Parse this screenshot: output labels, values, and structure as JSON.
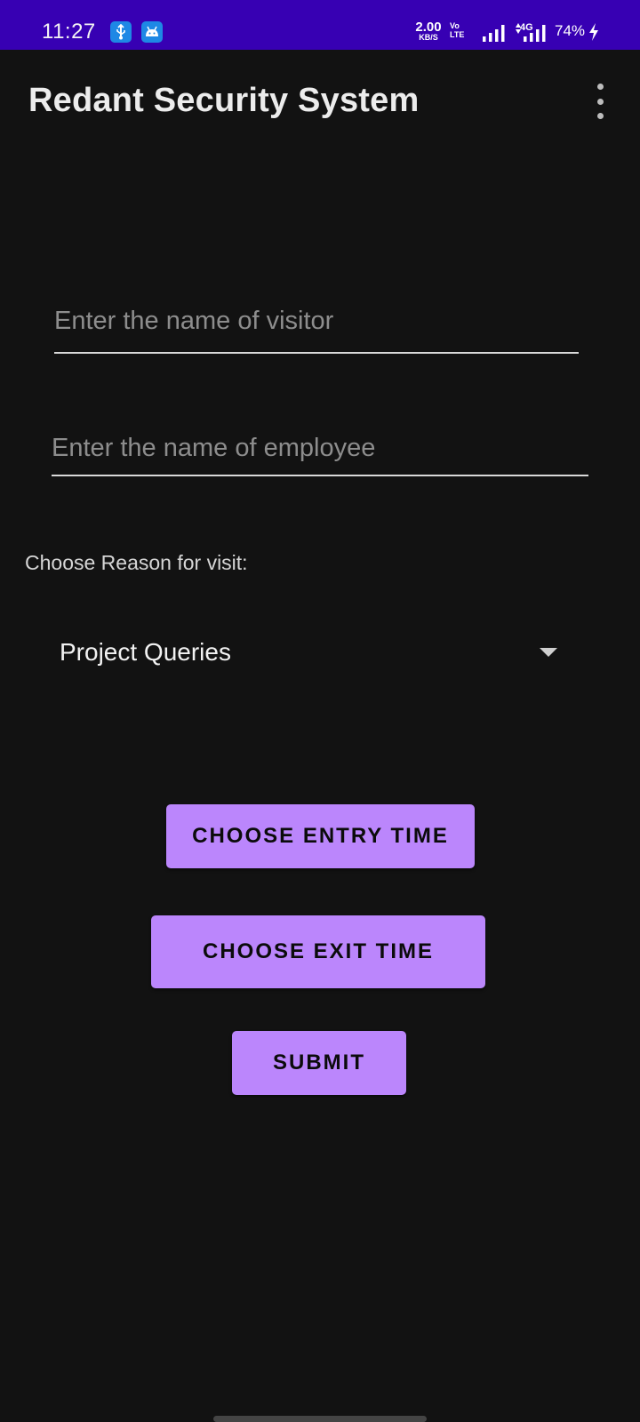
{
  "status_bar": {
    "time": "11:27",
    "notif_icons": [
      "usb-icon",
      "android-icon"
    ],
    "net_speed_value": "2.00",
    "net_speed_unit": "KB/S",
    "volte_top": "Vo",
    "volte_bottom": "LTE",
    "net_label": "4G",
    "battery": "74%",
    "background": "#3700b3"
  },
  "app_bar": {
    "title": "Redant Security System",
    "overflow_icon": "more-vert-icon"
  },
  "form": {
    "visitor_placeholder": "Enter the name of visitor",
    "employee_placeholder": "Enter the name of employee",
    "reason_label": "Choose Reason for visit:",
    "reason_selected": "Project Queries"
  },
  "buttons": {
    "entry_time": "CHOOSE ENTRY TIME",
    "exit_time": "CHOOSE EXIT TIME",
    "submit": "SUBMIT",
    "color": "#bb86fc"
  }
}
